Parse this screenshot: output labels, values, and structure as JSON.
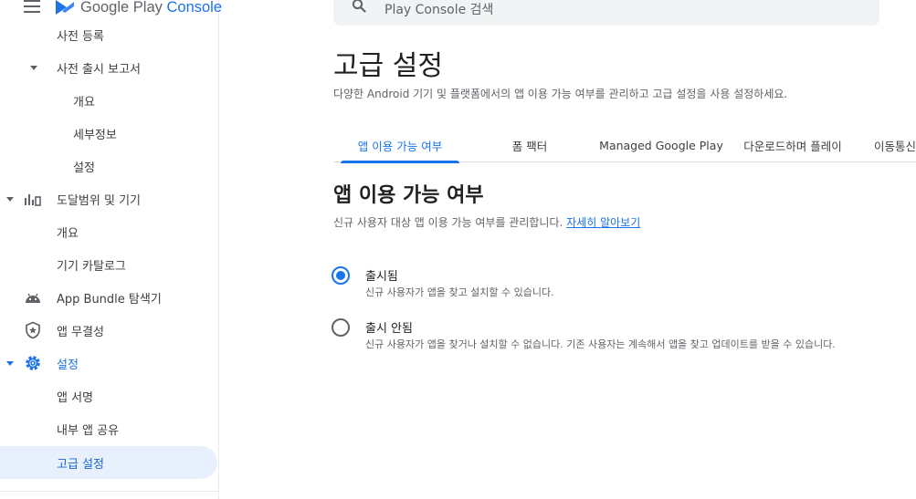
{
  "app": {
    "brand_prefix": "Google Play",
    "brand_suffix": "Console"
  },
  "search": {
    "placeholder": "Play Console 검색"
  },
  "sidebar": {
    "items": [
      {
        "label": "사전 등록"
      },
      {
        "label": "사전 출시 보고서"
      },
      {
        "label": "개요"
      },
      {
        "label": "세부정보"
      },
      {
        "label": "설정"
      },
      {
        "label": "도달범위 및 기기"
      },
      {
        "label": "개요"
      },
      {
        "label": "기기 카탈로그"
      },
      {
        "label": "App Bundle 탐색기"
      },
      {
        "label": "앱 무결성"
      },
      {
        "label": "설정"
      },
      {
        "label": "앱 서명"
      },
      {
        "label": "내부 앱 공유"
      },
      {
        "label": "고급 설정"
      }
    ]
  },
  "main": {
    "title": "고급 설정",
    "description": "다양한 Android 기기 및 플랫폼에서의 앱 이용 가능 여부를 관리하고 고급 설정을 사용 설정하세요.",
    "tabs": [
      {
        "label": "앱 이용 가능 여부"
      },
      {
        "label": "폼 팩터"
      },
      {
        "label": "Managed Google Play"
      },
      {
        "label": "다운로드하며 플레이"
      },
      {
        "label": "이동통신"
      }
    ],
    "section": {
      "title": "앱 이용 가능 여부",
      "description": "신규 사용자 대상 앱 이용 가능 여부를 관리합니다.",
      "link": "자세히 알아보기"
    },
    "options": [
      {
        "label": "출시됨",
        "sub": "신규 사용자가 앱을 찾고 설치할 수 있습니다.",
        "checked": true
      },
      {
        "label": "출시 안됨",
        "sub": "신규 사용자가 앱을 찾거나 설치할 수 없습니다. 기존 사용자는 계속해서 앱을 찾고 업데이트를 받을 수 있습니다.",
        "checked": false
      }
    ]
  },
  "colors": {
    "accent": "#1a73e8",
    "active_bg": "#e8f0fe",
    "text": "#202124",
    "muted": "#5f6368"
  }
}
